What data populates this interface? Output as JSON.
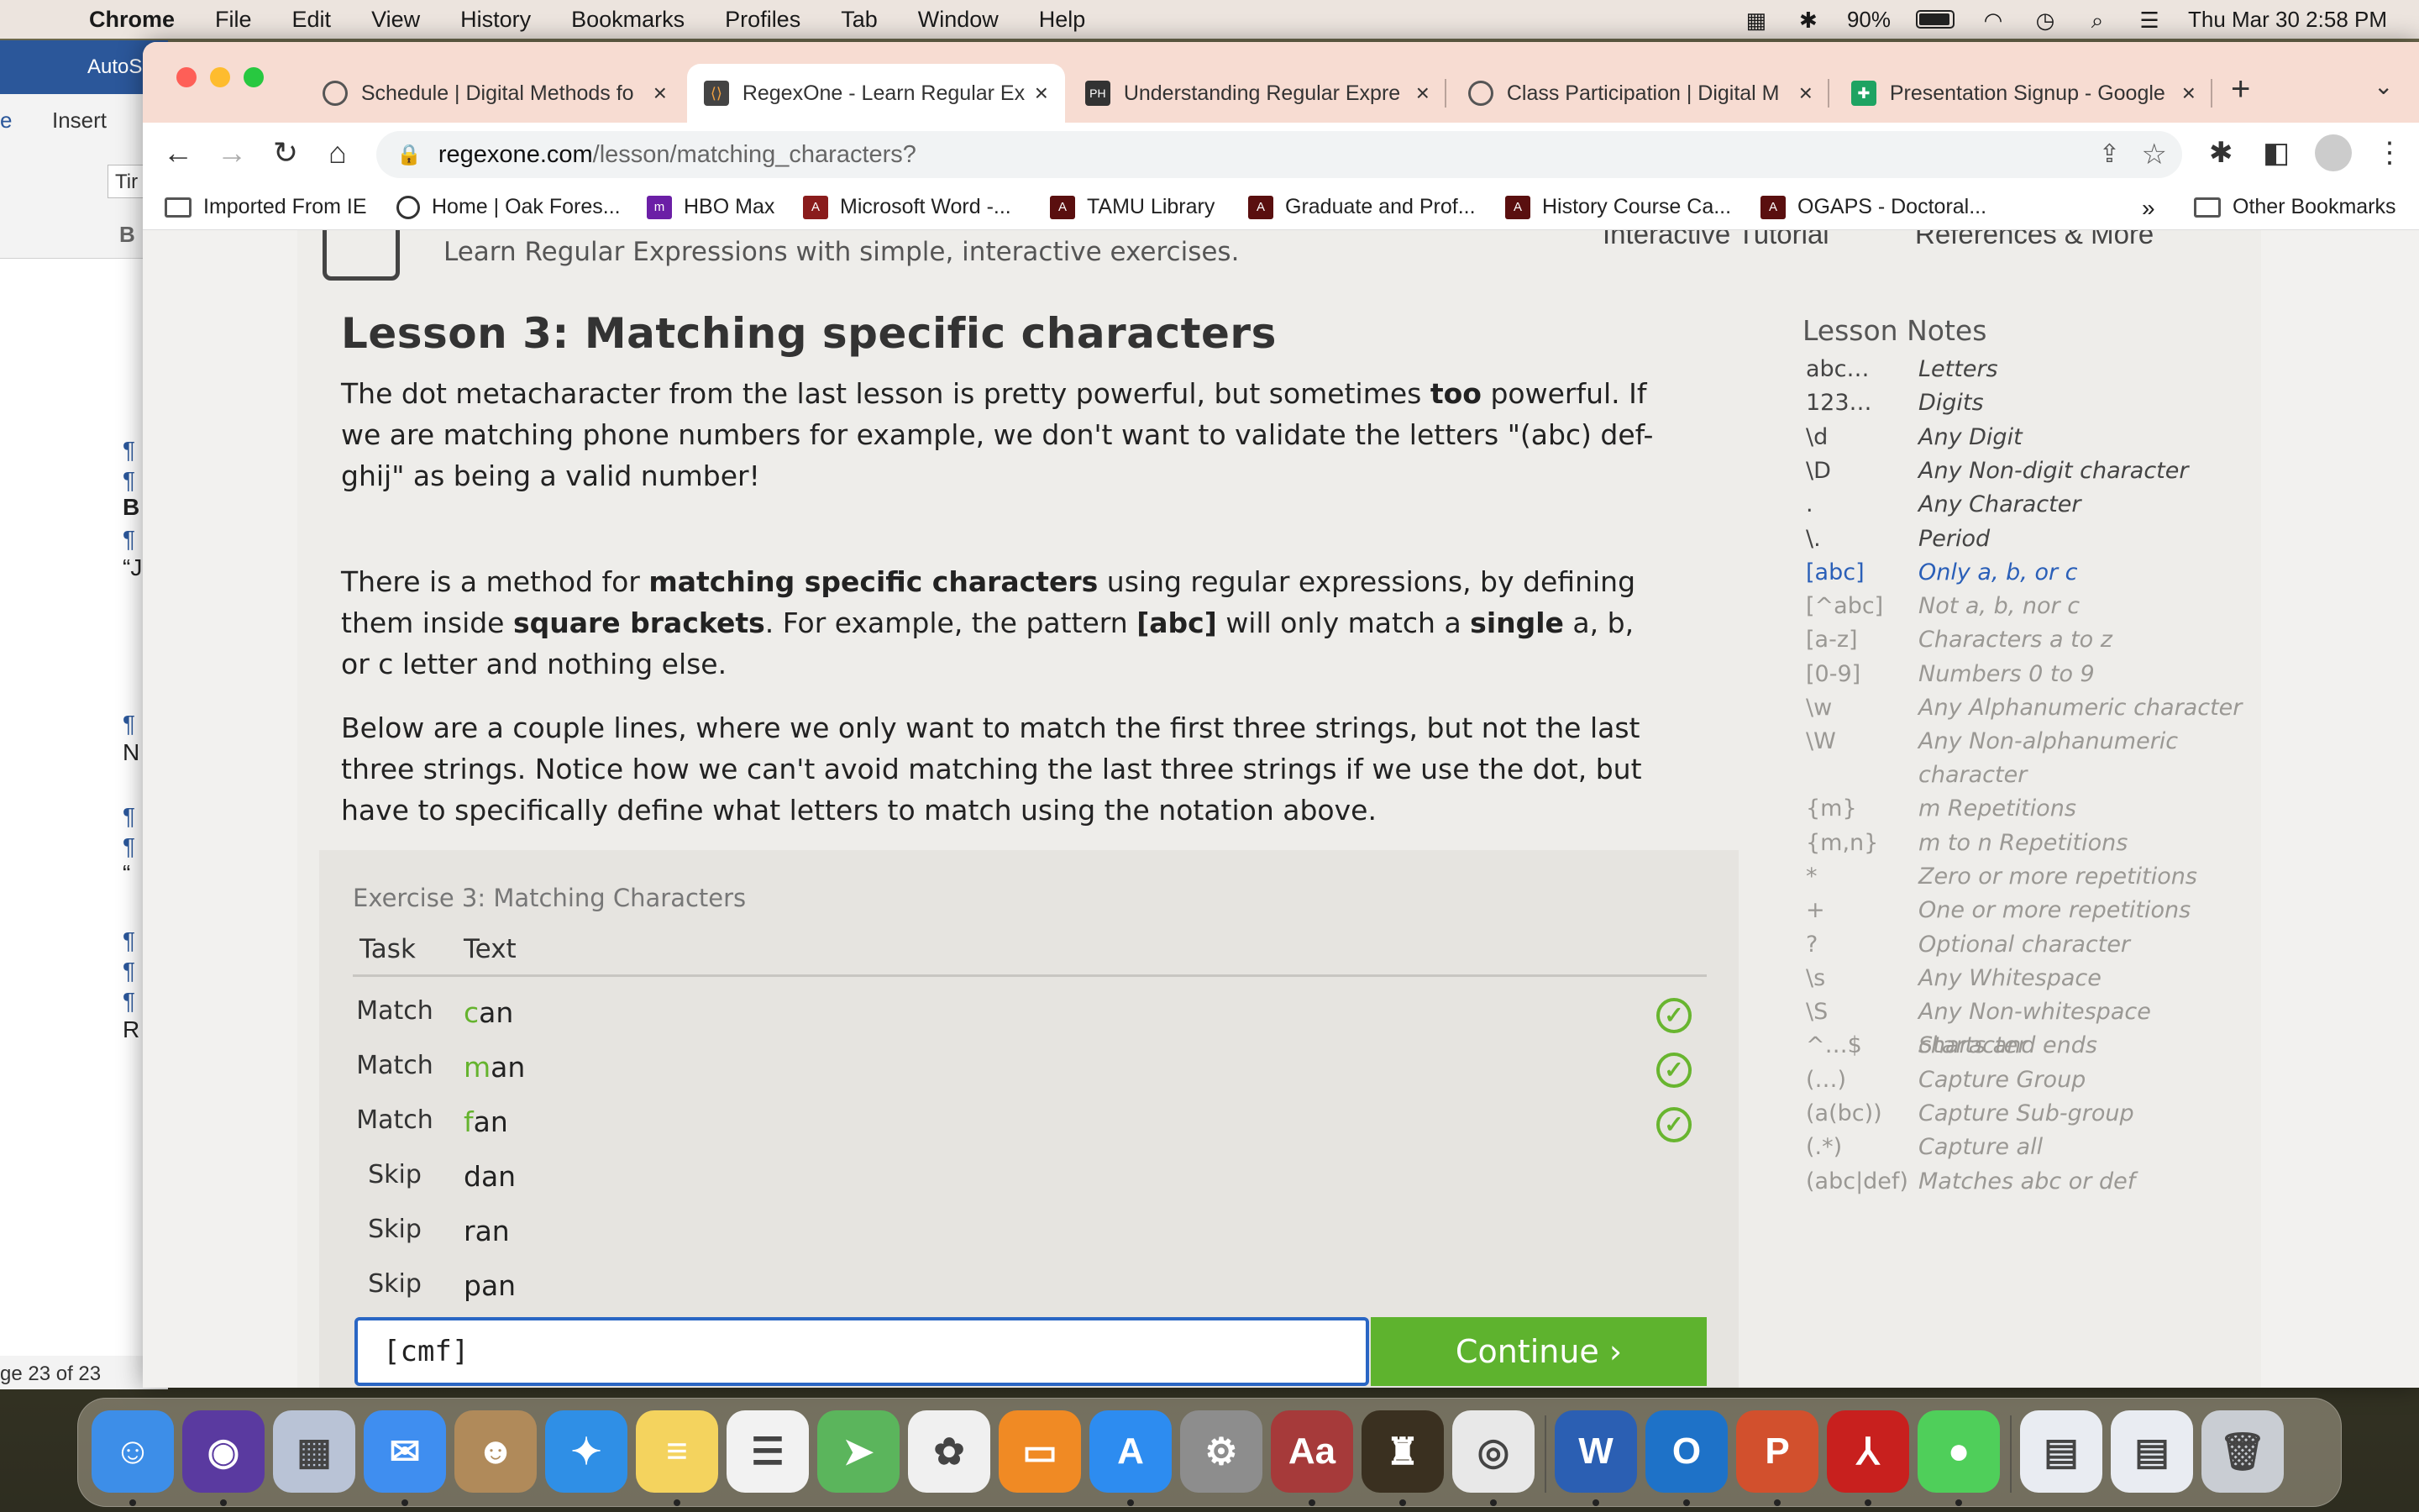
{
  "menubar": {
    "apple": "",
    "items": [
      "Chrome",
      "File",
      "Edit",
      "View",
      "History",
      "Bookmarks",
      "Profiles",
      "Tab",
      "Window",
      "Help"
    ],
    "battery": "90%",
    "clock": "Thu Mar 30  2:58 PM"
  },
  "word": {
    "title": "AutoS",
    "tab_home": "e",
    "tab_insert": "Insert",
    "font": "Tir",
    "bold": "B",
    "status": "ge 23 of 23",
    "margin_chars": [
      "B",
      "“J",
      "N",
      "“",
      "R"
    ]
  },
  "tabs": [
    {
      "label": "Schedule | Digital Methods fo",
      "active": false
    },
    {
      "label": "RegexOne - Learn Regular Ex",
      "active": true
    },
    {
      "label": "Understanding Regular Expre",
      "active": false
    },
    {
      "label": "Class Participation | Digital M",
      "active": false
    },
    {
      "label": "Presentation Signup - Google",
      "active": false
    }
  ],
  "tab_close": "×",
  "new_tab": "+",
  "omnibox": {
    "host": "regexone.com",
    "path": "/lesson/matching_characters?"
  },
  "bookmarks": [
    {
      "label": "Imported From IE"
    },
    {
      "label": "Home | Oak Fores..."
    },
    {
      "label": "HBO Max"
    },
    {
      "label": "Microsoft Word -..."
    },
    {
      "label": "TAMU Library"
    },
    {
      "label": "Graduate and Prof..."
    },
    {
      "label": "History Course Ca..."
    },
    {
      "label": "OGAPS - Doctoral..."
    }
  ],
  "bookmarks_overflow": "»",
  "other_bookmarks": "Other Bookmarks",
  "header": {
    "tagline": "Learn Regular Expressions with simple, interactive exercises.",
    "nav_tutorial": "Interactive Tutorial",
    "nav_refs": "References & More"
  },
  "lesson": {
    "title": "Lesson 3: Matching specific characters",
    "p1_a": "The dot metacharacter from the last lesson is pretty powerful, but sometimes ",
    "p1_b": "too",
    "p1_c": " powerful. If we are matching phone numbers for example, we don't want to validate the letters \"(abc) def-ghij\" as being a valid number!",
    "p2_a": "There is a method for ",
    "p2_b": "matching specific characters",
    "p2_c": " using regular expressions, by defining them inside ",
    "p2_d": "square brackets",
    "p2_e": ". For example, the pattern ",
    "p2_f": "[abc]",
    "p2_g": " will only match a ",
    "p2_h": "single",
    "p2_i": " a, b, or c letter and nothing else.",
    "p3": "Below are a couple lines, where we only want to match the first three strings, but not the last three strings. Notice how we can't avoid matching the last three strings if we use the dot, but have to specifically define what letters to match using the notation above."
  },
  "exercise": {
    "title": "Exercise 3: Matching Characters",
    "col_task": "Task",
    "col_text": "Text",
    "rows": [
      {
        "task": "Match",
        "first": "c",
        "rest": "an",
        "matched": true
      },
      {
        "task": "Match",
        "first": "m",
        "rest": "an",
        "matched": true
      },
      {
        "task": "Match",
        "first": "f",
        "rest": "an",
        "matched": true
      },
      {
        "task": "Skip",
        "first": "",
        "rest": "dan",
        "matched": false
      },
      {
        "task": "Skip",
        "first": "",
        "rest": "ran",
        "matched": false
      },
      {
        "task": "Skip",
        "first": "",
        "rest": "pan",
        "matched": false
      }
    ],
    "input_value": "[cmf]",
    "continue_label": "Continue ›"
  },
  "notes": {
    "title": "Lesson Notes",
    "items": [
      {
        "sym": "abc…",
        "desc": "Letters",
        "state": "done"
      },
      {
        "sym": "123…",
        "desc": "Digits",
        "state": "done"
      },
      {
        "sym": "\\d",
        "desc": "Any Digit",
        "state": "done"
      },
      {
        "sym": "\\D",
        "desc": "Any Non-digit character",
        "state": "done"
      },
      {
        "sym": ".",
        "desc": "Any Character",
        "state": "done"
      },
      {
        "sym": "\\.",
        "desc": "Period",
        "state": "done"
      },
      {
        "sym": "[abc]",
        "desc": "Only a, b, or c",
        "state": "current"
      },
      {
        "sym": "[^abc]",
        "desc": "Not a, b, nor c",
        "state": "todo"
      },
      {
        "sym": "[a-z]",
        "desc": "Characters a to z",
        "state": "todo"
      },
      {
        "sym": "[0-9]",
        "desc": "Numbers 0 to 9",
        "state": "todo"
      },
      {
        "sym": "\\w",
        "desc": "Any Alphanumeric character",
        "state": "todo"
      },
      {
        "sym": "\\W",
        "desc": "Any Non-alphanumeric character",
        "state": "todo"
      },
      {
        "sym": "{m}",
        "desc": "m Repetitions",
        "state": "todo"
      },
      {
        "sym": "{m,n}",
        "desc": "m to n Repetitions",
        "state": "todo"
      },
      {
        "sym": "*",
        "desc": "Zero or more repetitions",
        "state": "todo"
      },
      {
        "sym": "+",
        "desc": "One or more repetitions",
        "state": "todo"
      },
      {
        "sym": "?",
        "desc": "Optional character",
        "state": "todo"
      },
      {
        "sym": "\\s",
        "desc": "Any Whitespace",
        "state": "todo"
      },
      {
        "sym": "\\S",
        "desc": "Any Non-whitespace character",
        "state": "todo"
      },
      {
        "sym": "^…$",
        "desc": "Starts and ends",
        "state": "todo"
      },
      {
        "sym": "(…)",
        "desc": "Capture Group",
        "state": "todo"
      },
      {
        "sym": "(a(bc))",
        "desc": "Capture Sub-group",
        "state": "todo"
      },
      {
        "sym": "(.*)",
        "desc": "Capture all",
        "state": "todo"
      },
      {
        "sym": "(abc|def)",
        "desc": "Matches abc or def",
        "state": "todo"
      }
    ]
  },
  "dock": {
    "apps": [
      {
        "name": "finder",
        "color": "#3d8ee8",
        "glyph": "☺"
      },
      {
        "name": "siri",
        "color": "#5a3aa0",
        "glyph": "◉"
      },
      {
        "name": "launchpad",
        "color": "#b9c3d6",
        "glyph": "▦"
      },
      {
        "name": "mail",
        "color": "#3f8ef0",
        "glyph": "✉"
      },
      {
        "name": "contacts",
        "color": "#b08a5a",
        "glyph": "☻"
      },
      {
        "name": "safari",
        "color": "#2f8fe6",
        "glyph": "✦"
      },
      {
        "name": "notes",
        "color": "#f4d35e",
        "glyph": "≡"
      },
      {
        "name": "reminders",
        "color": "#f2f2f2",
        "glyph": "☰"
      },
      {
        "name": "maps",
        "color": "#5bb55c",
        "glyph": "➤"
      },
      {
        "name": "photos",
        "color": "#f0f0f0",
        "glyph": "✿"
      },
      {
        "name": "books",
        "color": "#f08a24",
        "glyph": "▭"
      },
      {
        "name": "app-store",
        "color": "#2d8cf0",
        "glyph": "A"
      },
      {
        "name": "system-preferences",
        "color": "#8d8d8d",
        "glyph": "⚙"
      },
      {
        "name": "dictionary",
        "color": "#a63a3a",
        "glyph": "Aa"
      },
      {
        "name": "medieval-ii",
        "color": "#3a3020",
        "glyph": "♜"
      },
      {
        "name": "chrome",
        "color": "#e8e8e8",
        "glyph": "◎"
      },
      {
        "name": "word",
        "color": "#2b5fb3",
        "glyph": "W"
      },
      {
        "name": "outlook",
        "color": "#1e72c8",
        "glyph": "O"
      },
      {
        "name": "powerpoint",
        "color": "#d2502d",
        "glyph": "P"
      },
      {
        "name": "acrobat",
        "color": "#c8201e",
        "glyph": "⅄"
      },
      {
        "name": "messages",
        "color": "#4fcf5a",
        "glyph": "●"
      },
      {
        "name": "doc-preview-1",
        "color": "#e9ecf2",
        "glyph": "▤"
      },
      {
        "name": "doc-preview-2",
        "color": "#e9ecf2",
        "glyph": "▤"
      },
      {
        "name": "trash",
        "color": "#c9cdd3",
        "glyph": "🗑"
      }
    ]
  }
}
